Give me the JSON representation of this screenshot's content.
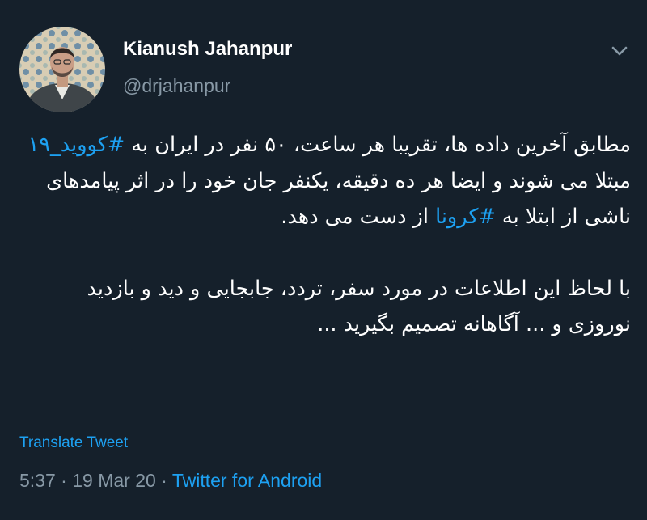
{
  "author": {
    "display_name": "Kianush Jahanpur",
    "handle": "@drjahanpur"
  },
  "tweet": {
    "paragraph1": {
      "t1": "مطابق آخرین داده ها، تقریبا هر ساعت، ۵۰ نفر در ایران به ",
      "hashtag1": "#کووید_۱۹",
      "t2": " مبتلا می شوند و ایضا هر ده دقیقه، یکنفر جان خود را در اثر پیامدهای ناشی از ابتلا به ",
      "hashtag2": "#کرونا",
      "t3": " از دست می دهد."
    },
    "paragraph2": "با لحاظ این اطلاعات در مورد سفر، تردد، جابجایی و دید و بازدید نوروزی و ... آگاهانه تصمیم بگیرید ..."
  },
  "translate_label": "Translate Tweet",
  "meta": {
    "time": "5:37",
    "separator": " · ",
    "date": "19 Mar 20",
    "source": "Twitter for Android"
  },
  "colors": {
    "background": "#15202b",
    "text": "#ffffff",
    "secondary": "#8899a6",
    "accent": "#1da1f2"
  },
  "icons": {
    "menu": "chevron-down-icon"
  }
}
